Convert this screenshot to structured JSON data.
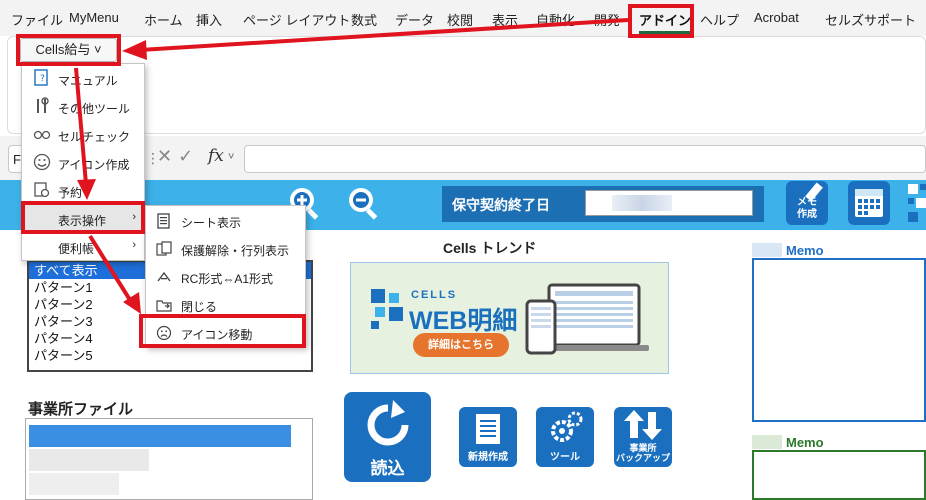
{
  "ribbon_tabs": [
    "ファイル",
    "MyMenu",
    "ホーム",
    "挿入",
    "ページ レイアウト",
    "数式",
    "データ",
    "校閲",
    "表示",
    "自動化",
    "開発",
    "アドイン",
    "ヘルプ",
    "Acrobat",
    "セルズサポート"
  ],
  "active_tab": "アドイン",
  "cells_menu_button": "Cells給与 ˅",
  "formula_bar": {
    "name_box": "F",
    "fx": "fx",
    "separator": "⋮",
    "cancel": "✕",
    "confirm": "✓",
    "caret": "˅"
  },
  "dropdown": {
    "items": [
      {
        "label": "マニュアル",
        "icon": "manual-icon"
      },
      {
        "label": "その他ツール",
        "icon": "tools-icon"
      },
      {
        "label": "セルチェック",
        "icon": "glasses-icon"
      },
      {
        "label": "アイコン作成",
        "icon": "smiley-icon"
      },
      {
        "label": "予約",
        "icon": "reserve-icon"
      },
      {
        "label": "表示操作",
        "arrow": "›"
      },
      {
        "label": "便利帳",
        "arrow": "›"
      }
    ]
  },
  "submenu": {
    "items": [
      {
        "label": "シート表示",
        "icon": "sheet-icon"
      },
      {
        "label": "保護解除・行列表示",
        "icon": "unprotect-icon"
      },
      {
        "label": "RC形式⇔A1形式",
        "icon": "swap-icon"
      },
      {
        "label": "閉じる",
        "icon": "close-folder-icon"
      },
      {
        "label": "アイコン移動",
        "icon": "frown-icon"
      }
    ]
  },
  "banner": {
    "support_label": "保守契約終了日"
  },
  "memo_icon_label": "メモ\n作成",
  "pattern_list": [
    "すべて表示",
    "パターン1",
    "パターン2",
    "パターン3",
    "パターン4",
    "パターン5"
  ],
  "trend": {
    "title": "Cells トレンド",
    "logo_small": "CELLS",
    "logo_big": "WEB明細",
    "cta": "詳細はこちら"
  },
  "office_file_title": "事業所ファイル",
  "memo": {
    "label1": "Memo",
    "label2": "Memo"
  },
  "actions": {
    "read": "読込",
    "new": "新規作成",
    "tools": "ツール",
    "backup": "事業所\nバックアップ"
  },
  "colors": {
    "banner_blue": "#3db1e9",
    "dark_blue": "#1a6fbf",
    "red_annotation": "#e0141e",
    "memo_blue": "#1f6fc6",
    "memo_green": "#2a7a2a"
  }
}
